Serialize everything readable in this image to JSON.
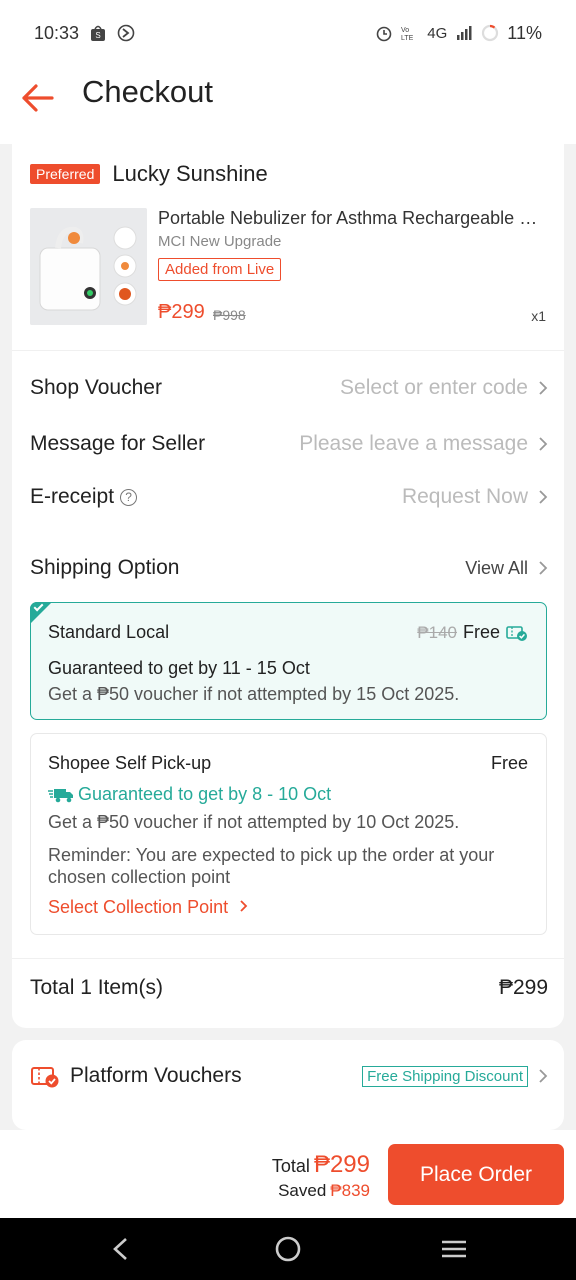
{
  "status_bar": {
    "time": "10:33",
    "network": "4G",
    "battery": "11%"
  },
  "header": {
    "title": "Checkout"
  },
  "shop": {
    "badge": "Preferred",
    "name": "Lucky Sunshine"
  },
  "product": {
    "name": "Portable Nebulizer for Asthma Rechargeable Nebulizer",
    "variation": "MCI New Upgrade",
    "tag": "Added from Live",
    "price": "₱299",
    "original_price": "₱998",
    "quantity": "x1"
  },
  "shop_voucher": {
    "label": "Shop Voucher",
    "placeholder": "Select or enter code"
  },
  "message": {
    "label": "Message for Seller",
    "placeholder": "Please leave a message"
  },
  "ereceipt": {
    "label": "E-receipt",
    "help": "?",
    "action": "Request Now"
  },
  "shipping": {
    "label": "Shipping Option",
    "view_all": "View All",
    "options": [
      {
        "name": "Standard Local",
        "original_fee": "₱140",
        "fee": "Free",
        "guarantee": "Guaranteed to get by 11 - 15 Oct",
        "voucher_note": "Get a ₱50 voucher if not attempted by 15 Oct 2025."
      },
      {
        "name": "Shopee Self Pick-up",
        "fee": "Free",
        "guarantee": "Guaranteed to get by 8 - 10 Oct",
        "voucher_note": "Get a ₱50 voucher if not attempted by 10 Oct 2025.",
        "reminder": "Reminder: You are expected to pick up the order at your chosen collection point",
        "action": "Select Collection Point"
      }
    ]
  },
  "total": {
    "label": "Total 1 Item(s)",
    "amount": "₱299"
  },
  "platform_vouchers": {
    "label": "Platform Vouchers",
    "tag": "Free Shipping Discount"
  },
  "footer": {
    "total_label": "Total",
    "total_amount": "₱299",
    "saved_label": "Saved",
    "saved_amount": "₱839",
    "place_order": "Place Order"
  },
  "colors": {
    "accent": "#ee4d2d",
    "teal": "#26aa99"
  }
}
